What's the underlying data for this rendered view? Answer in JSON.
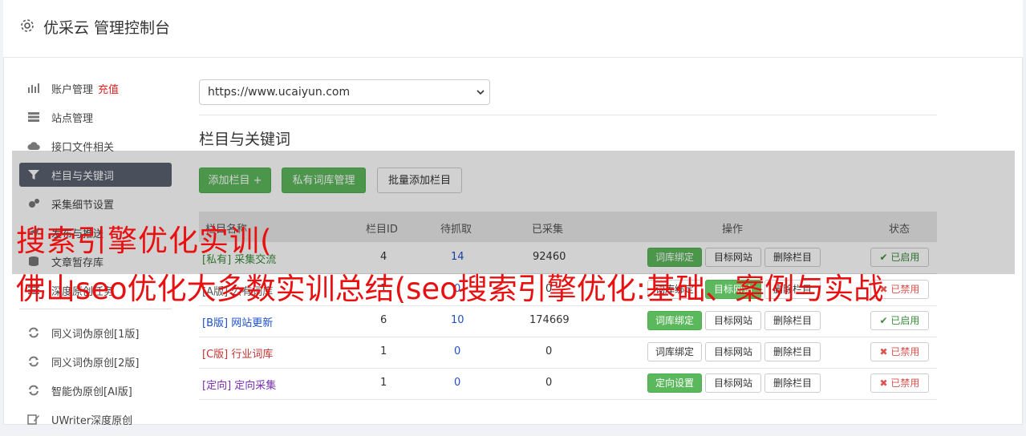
{
  "header": {
    "title": "优采云 管理控制台"
  },
  "sidebar": {
    "items": [
      {
        "label": "账户管理",
        "extra": "充值"
      },
      {
        "label": "站点管理"
      },
      {
        "label": "接口文件相关"
      },
      {
        "label": "栏目与关键词"
      },
      {
        "label": "采集细节设置"
      },
      {
        "label": "发布与推送"
      },
      {
        "label": "文章暂存库"
      },
      {
        "label": "深度原创任务"
      }
    ],
    "tools": [
      {
        "label": "同义词伪原创[1版]"
      },
      {
        "label": "同义词伪原创[2版]"
      },
      {
        "label": "智能伪原创[AI版]"
      },
      {
        "label": "UWriter深度原创"
      }
    ]
  },
  "site_select": {
    "value": "https://www.ucaiyun.com"
  },
  "section": {
    "title": "栏目与关键词"
  },
  "toolbar": {
    "add_column": "添加栏目 +",
    "private_lib": "私有词库管理",
    "batch_add": "批量添加栏目"
  },
  "table": {
    "headers": {
      "name": "栏目名称",
      "id": "栏目ID",
      "pending": "待抓取",
      "collected": "已采集",
      "actions": "操作",
      "status": "状态"
    },
    "rows": [
      {
        "tag": "[私有]",
        "name": "采集交流",
        "id": "4",
        "pending": "14",
        "collected": "92460",
        "bind": "词库绑定",
        "target": "目标网站",
        "delete": "删除栏目",
        "status": "已启用"
      },
      {
        "tag": "[A版]",
        "name": "公有词库",
        "id": "1",
        "pending": "0",
        "collected": "0",
        "bind": "词库绑定",
        "target": "目标网站",
        "delete": "删除栏目",
        "status": "已禁用"
      },
      {
        "tag": "[B版]",
        "name": "网站更新",
        "id": "6",
        "pending": "10",
        "collected": "174669",
        "bind": "词库绑定",
        "target": "目标网站",
        "delete": "删除栏目",
        "status": "已启用"
      },
      {
        "tag": "[C版]",
        "name": "行业词库",
        "id": "1",
        "pending": "0",
        "collected": "0",
        "bind": "词库绑定",
        "target": "目标网站",
        "delete": "删除栏目",
        "status": "已禁用"
      },
      {
        "tag": "[定向]",
        "name": "定向采集",
        "id": "1",
        "pending": "0",
        "collected": "0",
        "bind": "定向设置",
        "target": "目标网站",
        "delete": "删除栏目",
        "status": "已禁用"
      }
    ]
  },
  "watermark": {
    "line1": "搜索引擎优化实训(",
    "line2": "佛山seo优化大多数实训总结(seo搜索引擎优化:基础、案例与实战"
  },
  "colors": {
    "accent_green": "#5cb85c",
    "sidebar_active": "#5a6170",
    "watermark": "#e81010"
  }
}
